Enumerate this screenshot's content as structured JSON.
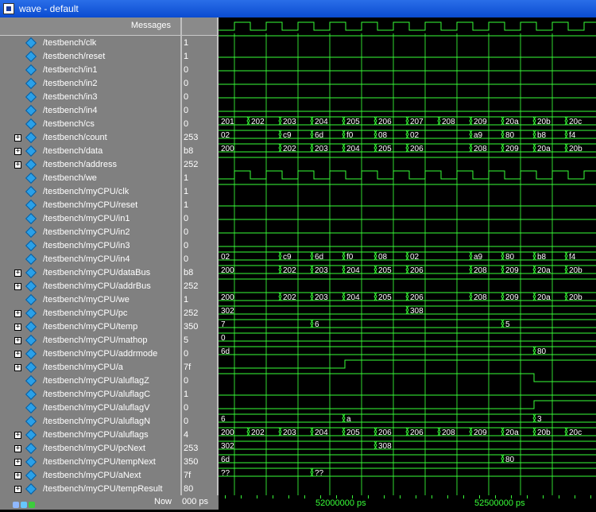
{
  "window": {
    "title": "wave - default"
  },
  "header": {
    "messages": "Messages"
  },
  "signals": [
    {
      "name": "/testbench/clk",
      "value": "1",
      "expandable": false,
      "type": "clock",
      "phase": 0
    },
    {
      "name": "/testbench/reset",
      "value": "1",
      "expandable": false,
      "type": "high"
    },
    {
      "name": "/testbench/in1",
      "value": "0",
      "expandable": false,
      "type": "low"
    },
    {
      "name": "/testbench/in2",
      "value": "0",
      "expandable": false,
      "type": "low"
    },
    {
      "name": "/testbench/in3",
      "value": "0",
      "expandable": false,
      "type": "low"
    },
    {
      "name": "/testbench/in4",
      "value": "0",
      "expandable": false,
      "type": "low"
    },
    {
      "name": "/testbench/cs",
      "value": "0",
      "expandable": false,
      "type": "low"
    },
    {
      "name": "/testbench/count",
      "value": "253",
      "expandable": true,
      "type": "bus",
      "labels": [
        "201",
        "202",
        "203",
        "204",
        "205",
        "206",
        "207",
        "208",
        "209",
        "20a",
        "20b",
        "20c"
      ]
    },
    {
      "name": "/testbench/data",
      "value": "b8",
      "expandable": true,
      "type": "bus",
      "labels": [
        "02",
        "",
        "c9",
        "6d",
        "f0",
        "08",
        "02",
        "",
        "a9",
        "80",
        "b8",
        "f4"
      ]
    },
    {
      "name": "/testbench/address",
      "value": "252",
      "expandable": true,
      "type": "bus",
      "labels": [
        "200",
        "",
        "202",
        "203",
        "204",
        "205",
        "206",
        "",
        "208",
        "209",
        "20a",
        "20b"
      ]
    },
    {
      "name": "/testbench/we",
      "value": "1",
      "expandable": false,
      "type": "high"
    },
    {
      "name": "/testbench/myCPU/clk",
      "value": "1",
      "expandable": false,
      "type": "clock",
      "phase": 0
    },
    {
      "name": "/testbench/myCPU/reset",
      "value": "1",
      "expandable": false,
      "type": "high"
    },
    {
      "name": "/testbench/myCPU/in1",
      "value": "0",
      "expandable": false,
      "type": "low"
    },
    {
      "name": "/testbench/myCPU/in2",
      "value": "0",
      "expandable": false,
      "type": "low"
    },
    {
      "name": "/testbench/myCPU/in3",
      "value": "0",
      "expandable": false,
      "type": "low"
    },
    {
      "name": "/testbench/myCPU/in4",
      "value": "0",
      "expandable": false,
      "type": "low"
    },
    {
      "name": "/testbench/myCPU/dataBus",
      "value": "b8",
      "expandable": true,
      "type": "bus",
      "labels": [
        "02",
        "",
        "c9",
        "6d",
        "f0",
        "08",
        "02",
        "",
        "a9",
        "80",
        "b8",
        "f4"
      ]
    },
    {
      "name": "/testbench/myCPU/addrBus",
      "value": "252",
      "expandable": true,
      "type": "bus",
      "labels": [
        "200",
        "",
        "202",
        "203",
        "204",
        "205",
        "206",
        "",
        "208",
        "209",
        "20a",
        "20b"
      ]
    },
    {
      "name": "/testbench/myCPU/we",
      "value": "1",
      "expandable": false,
      "type": "high"
    },
    {
      "name": "/testbench/myCPU/pc",
      "value": "252",
      "expandable": true,
      "type": "bus",
      "labels": [
        "200",
        "",
        "202",
        "203",
        "204",
        "205",
        "206",
        "",
        "208",
        "209",
        "20a",
        "20b"
      ]
    },
    {
      "name": "/testbench/myCPU/temp",
      "value": "350",
      "expandable": true,
      "type": "bus",
      "labels": [
        "302",
        "",
        "",
        "",
        "",
        "",
        "308",
        "",
        "",
        "",
        "",
        ""
      ]
    },
    {
      "name": "/testbench/myCPU/mathop",
      "value": "5",
      "expandable": true,
      "type": "bus",
      "labels": [
        "7",
        "",
        "",
        "6",
        "",
        "",
        "",
        "",
        "",
        "5",
        "",
        ""
      ]
    },
    {
      "name": "/testbench/myCPU/addrmode",
      "value": "0",
      "expandable": true,
      "type": "bus",
      "labels": [
        "0",
        "",
        "",
        "",
        "",
        "",
        "",
        "",
        "",
        "",
        "",
        ""
      ]
    },
    {
      "name": "/testbench/myCPU/a",
      "value": "7f",
      "expandable": true,
      "type": "bus",
      "labels": [
        "6d",
        "",
        "",
        "",
        "",
        "",
        "",
        "",
        "",
        "",
        "80",
        ""
      ]
    },
    {
      "name": "/testbench/myCPU/aluflagZ",
      "value": "0",
      "expandable": false,
      "type": "stepup",
      "at": 4
    },
    {
      "name": "/testbench/myCPU/aluflagC",
      "value": "1",
      "expandable": false,
      "type": "stepdown",
      "at": 10
    },
    {
      "name": "/testbench/myCPU/aluflagV",
      "value": "0",
      "expandable": false,
      "type": "low"
    },
    {
      "name": "/testbench/myCPU/aluflagN",
      "value": "0",
      "expandable": false,
      "type": "stepup",
      "at": 10
    },
    {
      "name": "/testbench/myCPU/aluflags",
      "value": "4",
      "expandable": true,
      "type": "bus",
      "labels": [
        "6",
        "",
        "",
        "",
        "a",
        "",
        "",
        "",
        "",
        "",
        "3",
        ""
      ]
    },
    {
      "name": "/testbench/myCPU/pcNext",
      "value": "253",
      "expandable": true,
      "type": "bus",
      "labels": [
        "200",
        "202",
        "203",
        "204",
        "205",
        "206",
        "206",
        "208",
        "209",
        "20a",
        "20b",
        "20c"
      ]
    },
    {
      "name": "/testbench/myCPU/tempNext",
      "value": "350",
      "expandable": true,
      "type": "bus",
      "labels": [
        "302",
        "",
        "",
        "",
        "",
        "308",
        "",
        "",
        "",
        "",
        "",
        ""
      ]
    },
    {
      "name": "/testbench/myCPU/aNext",
      "value": "7f",
      "expandable": true,
      "type": "bus",
      "labels": [
        "6d",
        "",
        "",
        "",
        "",
        "",
        "",
        "",
        "",
        "80",
        "",
        ""
      ]
    },
    {
      "name": "/testbench/myCPU/tempResult",
      "value": "80",
      "expandable": true,
      "type": "bus",
      "labels": [
        "??",
        "",
        "",
        "??",
        "",
        "",
        "",
        "",
        "",
        "",
        "",
        ""
      ]
    }
  ],
  "footer": {
    "now_label": "Now",
    "now_value": "000 ps",
    "time_labels": [
      {
        "text": "52000000 ps",
        "t": 4
      },
      {
        "text": "52500000 ps",
        "t": 9
      }
    ]
  },
  "colors": {
    "wave": "#38ff38",
    "bus_text": "#ffffff",
    "grid": "#4a4a4a",
    "cursor": "#38ff38"
  }
}
